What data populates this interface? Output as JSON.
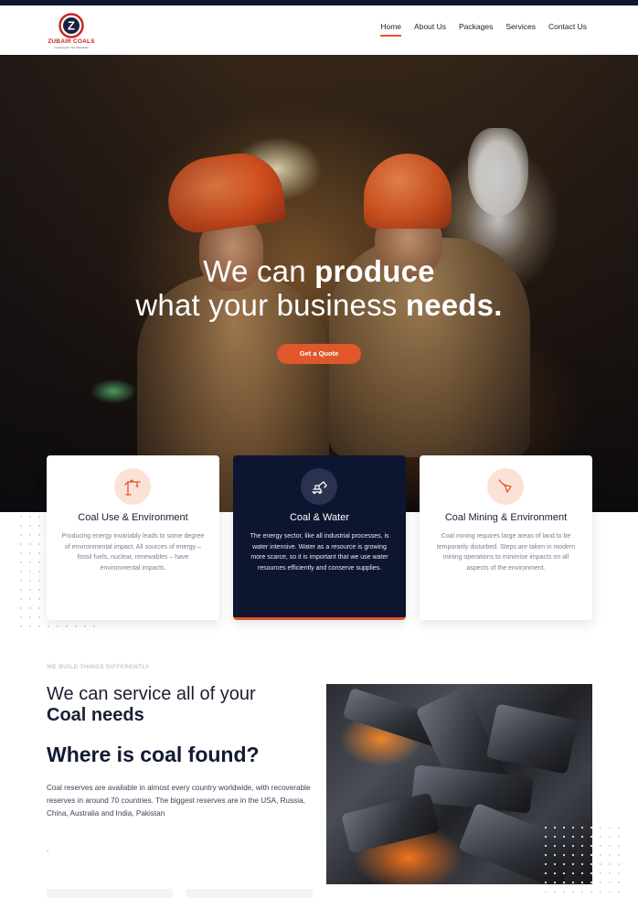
{
  "brand": {
    "name": "ZUBAIR COALS",
    "tagline": "Investing On The Standards",
    "logo_letter": "Z",
    "colors": {
      "accent": "#e0572b",
      "navy": "#0d1530",
      "logo_red": "#c8281e"
    }
  },
  "nav": {
    "items": [
      {
        "label": "Home",
        "active": true
      },
      {
        "label": "About Us",
        "active": false
      },
      {
        "label": "Packages",
        "active": false
      },
      {
        "label": "Services",
        "active": false
      },
      {
        "label": "Contact Us",
        "active": false
      }
    ]
  },
  "hero": {
    "line1_light": "We can ",
    "line1_bold": "produce",
    "line2_light": "what your business ",
    "line2_bold": "needs.",
    "cta_label": "Get a Quote"
  },
  "cards": [
    {
      "icon": "tower-crane-icon",
      "title": "Coal Use & Environment",
      "text": "Producing energy invariably leads to some degree of environmental impact. All sources of energy – fossil fuels, nuclear, renewables – have environmental impacts."
    },
    {
      "icon": "excavator-icon",
      "title": "Coal & Water",
      "text": "The energy sector, like all industrial processes, is water intensive. Water as a resource is growing more scarce, so it is important that we use water resources efficiently and conserve supplies."
    },
    {
      "icon": "trowel-icon",
      "title": "Coal Mining & Environment",
      "text": "Coal mining requires large areas of land to be temporarily disturbed. Steps are taken in modern mining operations to minimise impacts on all aspects of the environment."
    }
  ],
  "about": {
    "eyebrow": "WE BUILD THINGS DIFFERENTLY",
    "heading_light": "We can service all of your",
    "heading_bold": "Coal needs",
    "found_title": "Where is coal found?",
    "found_text": "Coal reserves are available in almost every country worldwide, with recoverable reserves in around 70 countries. The biggest reserves are in the USA, Russia, China, Australia and India, Pakistan",
    "trailing": "."
  }
}
